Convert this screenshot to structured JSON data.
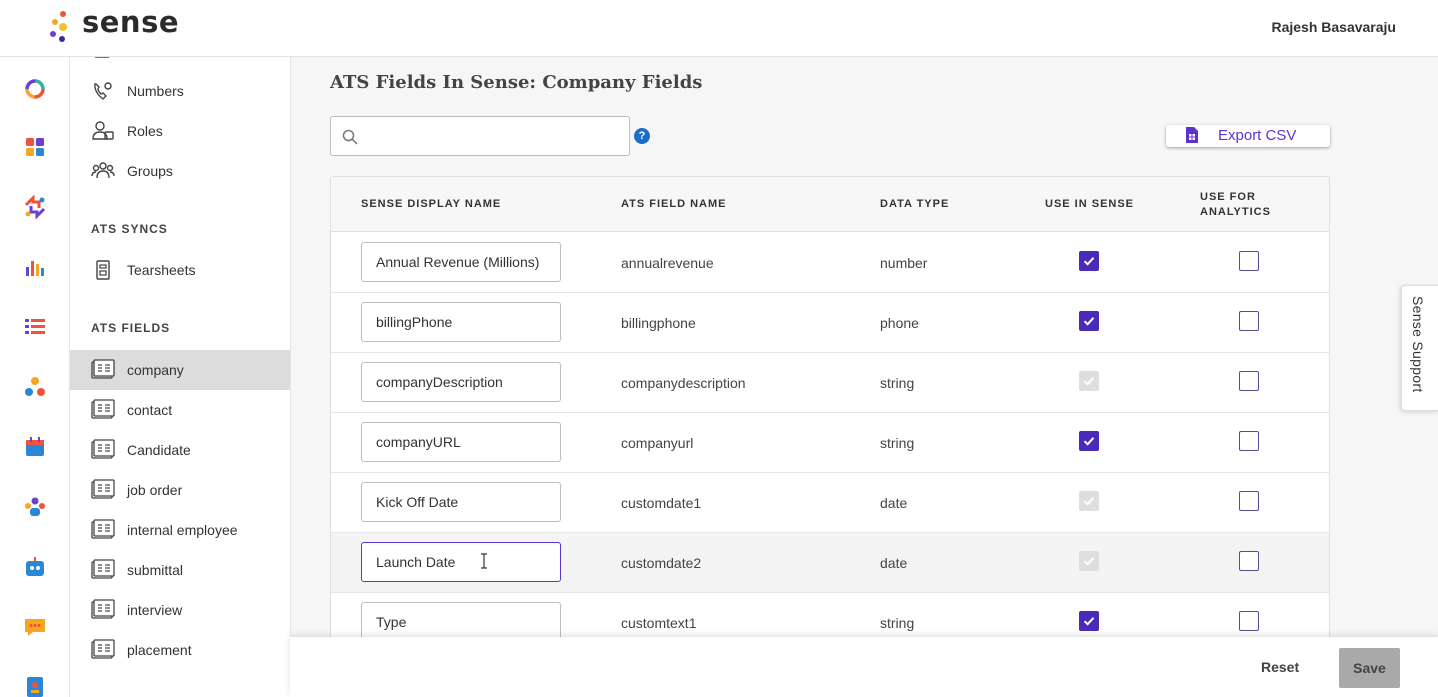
{
  "app": {
    "logo_text": "sense",
    "user_name": "Rajesh Basavaraju"
  },
  "rail": {
    "icons": [
      "sense-ring-icon",
      "dashboard-grid-icon",
      "sync-arrows-icon",
      "analytics-bars-icon",
      "list-icon",
      "people-network-icon",
      "calendar-icon",
      "team-icon",
      "chatbot-icon",
      "messages-icon",
      "contacts-book-icon"
    ]
  },
  "subnav": {
    "items_top": [
      {
        "label": "Numbers",
        "icon": "phone-settings-icon"
      },
      {
        "label": "Roles",
        "icon": "user-roles-icon"
      },
      {
        "label": "Groups",
        "icon": "groups-icon"
      }
    ],
    "ats_syncs_title": "ATS SYNCS",
    "ats_syncs_items": [
      {
        "label": "Tearsheets",
        "icon": "tearsheet-icon"
      }
    ],
    "ats_fields_title": "ATS FIELDS",
    "ats_fields_items": [
      {
        "label": "company",
        "active": true
      },
      {
        "label": "contact"
      },
      {
        "label": "Candidate"
      },
      {
        "label": "job order"
      },
      {
        "label": "internal employee"
      },
      {
        "label": "submittal"
      },
      {
        "label": "interview"
      },
      {
        "label": "placement"
      }
    ]
  },
  "main": {
    "title": "ATS Fields In Sense: Company Fields",
    "search": {
      "value": "",
      "placeholder": ""
    },
    "help_label": "?",
    "export_label": "Export CSV"
  },
  "table": {
    "headers": {
      "display_name": "SENSE DISPLAY NAME",
      "ats_field": "ATS FIELD NAME",
      "data_type": "DATA TYPE",
      "use_in_sense": "USE IN SENSE",
      "use_for_analytics_1": "USE FOR",
      "use_for_analytics_2": "ANALYTICS"
    },
    "rows": [
      {
        "display": "Annual Revenue (Millions)",
        "field": "annualrevenue",
        "type": "number",
        "use_in_sense": "checked",
        "analytics": "empty"
      },
      {
        "display": "billingPhone",
        "field": "billingphone",
        "type": "phone",
        "use_in_sense": "checked",
        "analytics": "empty"
      },
      {
        "display": "companyDescription",
        "field": "companydescription",
        "type": "string",
        "use_in_sense": "disabled",
        "analytics": "empty"
      },
      {
        "display": "companyURL",
        "field": "companyurl",
        "type": "string",
        "use_in_sense": "checked",
        "analytics": "empty"
      },
      {
        "display": "Kick Off Date",
        "field": "customdate1",
        "type": "date",
        "use_in_sense": "disabled",
        "analytics": "empty"
      },
      {
        "display": "Launch Date",
        "field": "customdate2",
        "type": "date",
        "use_in_sense": "disabled",
        "analytics": "empty"
      },
      {
        "display": "Type",
        "field": "customtext1",
        "type": "string",
        "use_in_sense": "checked",
        "analytics": "empty"
      }
    ]
  },
  "support_label": "Sense Support",
  "footer": {
    "reset_label": "Reset",
    "save_label": "Save"
  },
  "colors": {
    "accent": "#5b35c9",
    "checkbox": "#4a2ab8",
    "active_nav": "#dcdcdc"
  }
}
